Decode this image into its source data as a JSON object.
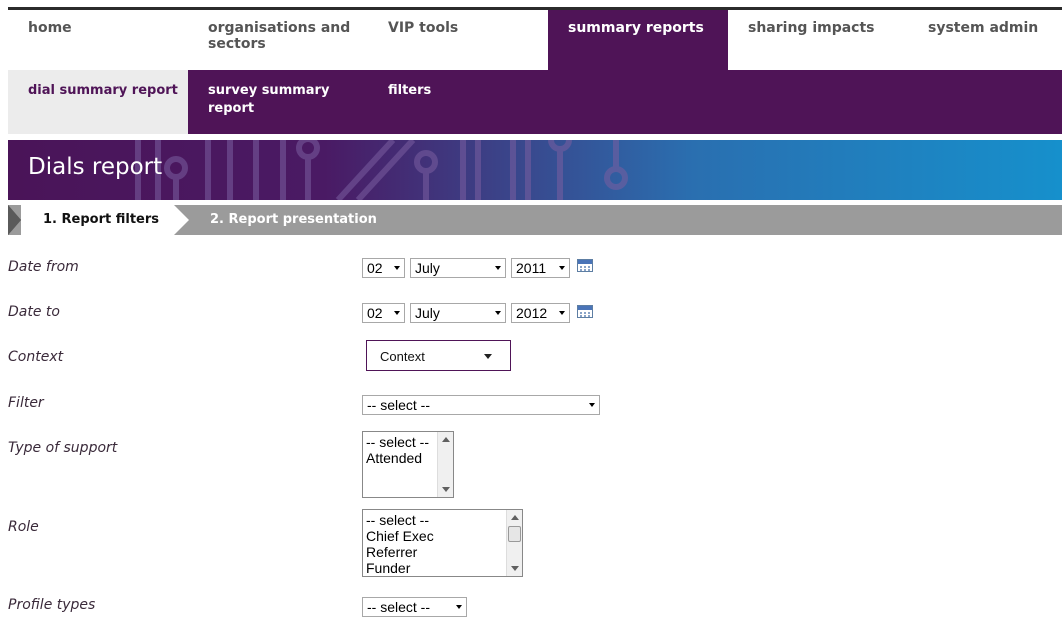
{
  "main_nav": [
    "home",
    "organisations and sectors",
    "VIP tools",
    "summary reports",
    "sharing impacts",
    "system admin"
  ],
  "sub_nav": [
    "dial summary report",
    "survey summary report",
    "filters"
  ],
  "banner": {
    "title": "Dials report"
  },
  "steps": [
    "1. Report filters",
    "2. Report presentation"
  ],
  "form": {
    "date_from": {
      "label": "Date from",
      "day": "02",
      "month": "July",
      "year": "2011",
      "calendar_icon": "calendar-icon"
    },
    "date_to": {
      "label": "Date to",
      "day": "02",
      "month": "July",
      "year": "2012",
      "calendar_icon": "calendar-icon"
    },
    "context": {
      "label": "Context",
      "button": "Context"
    },
    "filter": {
      "label": "Filter",
      "value": "-- select --"
    },
    "type_of_support": {
      "label": "Type of support",
      "options": [
        "-- select --",
        "Attended"
      ]
    },
    "role": {
      "label": "Role",
      "options": [
        "-- select --",
        "Chief Exec",
        "Referrer",
        "Funder"
      ]
    },
    "profile_types": {
      "label": "Profile types",
      "value": "-- select --"
    }
  },
  "colors": {
    "brand_purple": "#4f1457",
    "banner_blue": "#1690cc",
    "step_gray": "#9b9b9b"
  }
}
